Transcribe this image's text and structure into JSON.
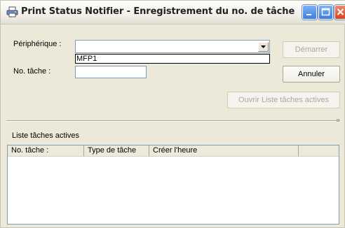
{
  "window": {
    "title": "Print Status Notifier - Enregistrement du no. de tâche",
    "app_icon": "printer-icon",
    "controls": [
      "minimize-icon",
      "maximize-icon",
      "close-icon"
    ]
  },
  "form": {
    "device_label": "Périphérique :",
    "device_value": "",
    "device_options": [
      "MFP1"
    ],
    "job_label": "No. tâche :",
    "job_value": ""
  },
  "buttons": {
    "start": "Démarrer",
    "cancel": "Annuler",
    "open_active": "Ouvrir Liste tâches actives"
  },
  "active_list": {
    "label": "Liste tâches actives",
    "columns": [
      "No. tâche :",
      "Type de tâche",
      "Créer l'heure"
    ],
    "rows": []
  }
}
